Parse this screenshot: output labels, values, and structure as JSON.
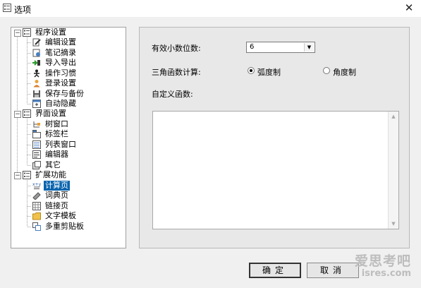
{
  "window": {
    "title": "选项",
    "title_icon": "options-window-icon",
    "close_icon": "close-x-icon"
  },
  "tree": {
    "items": [
      {
        "label": "程序设置",
        "level": 0,
        "expanded": true,
        "icon": "settings-group-icon"
      },
      {
        "label": "编辑设置",
        "level": 1,
        "icon": "edit-settings-icon"
      },
      {
        "label": "笔记摘录",
        "level": 1,
        "icon": "note-excerpt-icon"
      },
      {
        "label": "导入导出",
        "level": 1,
        "icon": "import-export-icon"
      },
      {
        "label": "操作习惯",
        "level": 1,
        "icon": "operation-habits-icon"
      },
      {
        "label": "登录设置",
        "level": 1,
        "icon": "login-user-icon"
      },
      {
        "label": "保存与备份",
        "level": 1,
        "icon": "save-backup-icon"
      },
      {
        "label": "自动隐藏",
        "level": 1,
        "icon": "auto-hide-icon"
      },
      {
        "label": "界面设置",
        "level": 0,
        "expanded": true,
        "icon": "settings-group-icon"
      },
      {
        "label": "树窗口",
        "level": 1,
        "icon": "tree-window-icon"
      },
      {
        "label": "标签栏",
        "level": 1,
        "icon": "tab-bar-icon"
      },
      {
        "label": "列表窗口",
        "level": 1,
        "icon": "list-window-icon"
      },
      {
        "label": "编辑器",
        "level": 1,
        "icon": "editor-icon"
      },
      {
        "label": "其它",
        "level": 1,
        "icon": "other-icon"
      },
      {
        "label": "扩展功能",
        "level": 0,
        "expanded": true,
        "icon": "settings-group-icon"
      },
      {
        "label": "计算页",
        "level": 1,
        "selected": true,
        "icon": "calculator-icon"
      },
      {
        "label": "词典页",
        "level": 1,
        "icon": "dictionary-icon"
      },
      {
        "label": "链接页",
        "level": 1,
        "icon": "links-icon"
      },
      {
        "label": "文字模板",
        "level": 1,
        "icon": "text-template-icon"
      },
      {
        "label": "多重剪贴板",
        "level": 1,
        "icon": "multi-clipboard-icon"
      }
    ]
  },
  "calc_page": {
    "decimals_label": "有效小数位数:",
    "decimals_value": "6",
    "trig_label": "三角函数计算:",
    "radian_label": "弧度制",
    "degree_label": "角度制",
    "selected_unit": "radian",
    "custom_func_label": "自定义函数:",
    "custom_func_value": ""
  },
  "buttons": {
    "ok": "确定",
    "cancel": "取消"
  },
  "watermark": {
    "line1": "爱思考吧",
    "line2": "isres.com"
  },
  "colors": {
    "selection": "#0a64ad",
    "window_bg": "#f0f0f0",
    "panel_bg": "#e8e8e8"
  }
}
